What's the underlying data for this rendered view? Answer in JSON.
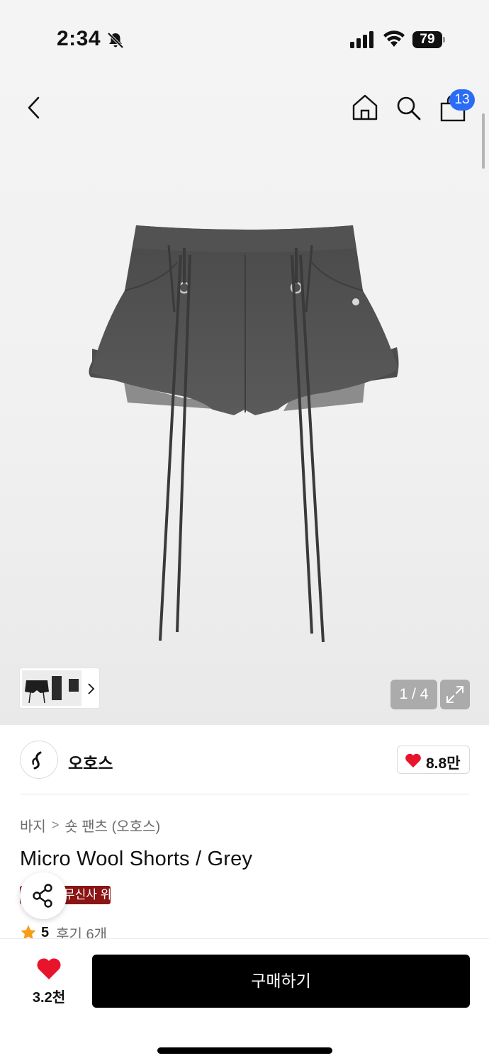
{
  "status_bar": {
    "time": "2:34",
    "battery_level": "79"
  },
  "header": {
    "cart_badge_count": "13"
  },
  "gallery": {
    "page_indicator": "1 / 4",
    "current_page": 1,
    "total_pages": 4
  },
  "brand": {
    "name": "오호스",
    "like_count": "8.8만"
  },
  "product": {
    "breadcrumb": [
      "바지",
      "숏 팬츠 (오호스)"
    ],
    "breadcrumb_separator": ">",
    "title": "Micro Wool Shorts / Grey",
    "promo_badge": "무신사 위크스위크",
    "rating_score": "5",
    "review_count": "후기 6개"
  },
  "bottom_bar": {
    "wish_count": "3.2천",
    "buy_label": "구매하기"
  },
  "colors": {
    "accent_blue": "#2b6cf6",
    "heart_red": "#e8142b",
    "badge_red": "#8b1414",
    "star_orange": "#f59d1a"
  }
}
